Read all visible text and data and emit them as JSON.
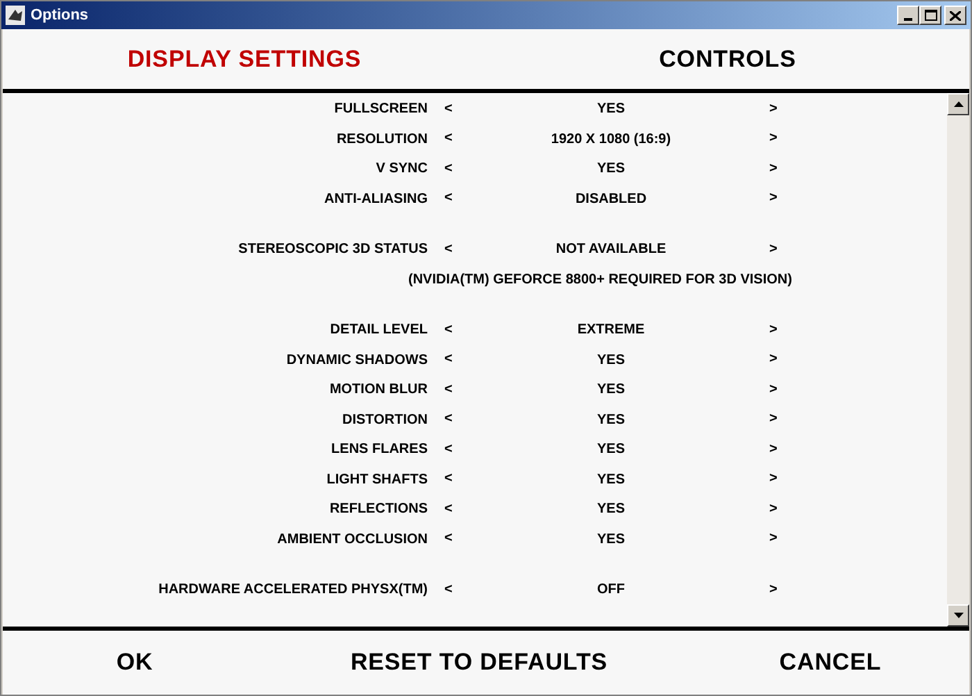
{
  "window": {
    "title": "Options"
  },
  "tabs": [
    {
      "label": "DISPLAY SETTINGS",
      "selected": true
    },
    {
      "label": "CONTROLS",
      "selected": false
    }
  ],
  "settings": [
    {
      "rows": [
        {
          "kind": "option",
          "label": "FULLSCREEN",
          "prev": "<",
          "value": "YES",
          "next": ">"
        },
        {
          "kind": "option",
          "label": "RESOLUTION",
          "prev": "<",
          "value": "1920 X 1080 (16:9)",
          "next": ">"
        },
        {
          "kind": "option",
          "label": "V SYNC",
          "prev": "<",
          "value": "YES",
          "next": ">"
        },
        {
          "kind": "option",
          "label": "ANTI-ALIASING",
          "prev": "<",
          "value": "DISABLED",
          "next": ">"
        }
      ]
    },
    {
      "rows": [
        {
          "kind": "option",
          "label": "STEREOSCOPIC 3D STATUS",
          "prev": "<",
          "value": "NOT AVAILABLE",
          "next": ">"
        },
        {
          "kind": "note",
          "text": "(NVIDIA(TM) GEFORCE 8800+ REQUIRED FOR 3D VISION)"
        }
      ]
    },
    {
      "rows": [
        {
          "kind": "option",
          "label": "DETAIL LEVEL",
          "prev": "<",
          "value": "EXTREME",
          "next": ">"
        },
        {
          "kind": "option",
          "label": "DYNAMIC SHADOWS",
          "prev": "<",
          "value": "YES",
          "next": ">"
        },
        {
          "kind": "option",
          "label": "MOTION BLUR",
          "prev": "<",
          "value": "YES",
          "next": ">"
        },
        {
          "kind": "option",
          "label": "DISTORTION",
          "prev": "<",
          "value": "YES",
          "next": ">"
        },
        {
          "kind": "option",
          "label": "LENS FLARES",
          "prev": "<",
          "value": "YES",
          "next": ">"
        },
        {
          "kind": "option",
          "label": "LIGHT SHAFTS",
          "prev": "<",
          "value": "YES",
          "next": ">"
        },
        {
          "kind": "option",
          "label": "REFLECTIONS",
          "prev": "<",
          "value": "YES",
          "next": ">"
        },
        {
          "kind": "option",
          "label": "AMBIENT OCCLUSION",
          "prev": "<",
          "value": "YES",
          "next": ">"
        }
      ]
    },
    {
      "rows": [
        {
          "kind": "option",
          "label": "HARDWARE ACCELERATED PHYSX(TM)",
          "prev": "<",
          "value": "OFF",
          "next": ">"
        }
      ]
    }
  ],
  "buttons": [
    "OK",
    "RESET TO DEFAULTS",
    "CANCEL"
  ]
}
